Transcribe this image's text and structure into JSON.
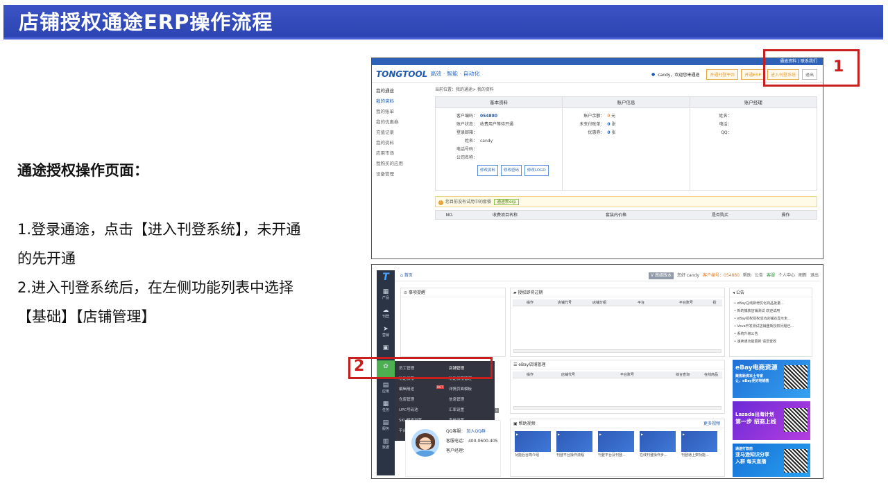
{
  "slide": {
    "title": "店铺授权通途ERP操作流程",
    "subhead": "通途授权操作页面：",
    "steps": [
      "1.登录通途，点击【进入刊登系统】，未开通",
      "的先开通",
      "2.进入刊登系统后，在左侧功能列表中选择",
      "【基础】【店铺管理】"
    ],
    "markers": {
      "one": "1",
      "two": "2"
    },
    "marker_color": "#c81e1e",
    "title_bg": "#3049b8"
  },
  "shot1": {
    "top_links": "通途资料 | 联系我们",
    "logo": "TONGTOOL",
    "slogan": "高效 · 智能 · 自动化",
    "welcome": "candy，欢迎您来通途",
    "header_buttons": [
      "开通刊登平台",
      "开通ERP",
      "进入刊登系统",
      "退出"
    ],
    "sidebar_title": "我的通途",
    "sidebar_items": [
      "我的资料",
      "我的账单",
      "我的优惠券",
      "充值记录",
      "我的资料",
      "应用市场",
      "我购买的应用",
      "设备管理"
    ],
    "crumb": "当前位置：我的通途> 我的资料",
    "cols": [
      "基本资料",
      "账户信息",
      "账户经理"
    ],
    "basic": {
      "rows": [
        {
          "k": "客户编码：",
          "v": "054880"
        },
        {
          "k": "账户状态：",
          "v": "收费用户等待开通"
        },
        {
          "k": "登录邮箱：",
          "v": ""
        },
        {
          "k": "姓名：",
          "v": "candy"
        },
        {
          "k": "电话号码：",
          "v": ""
        },
        {
          "k": "公司名称：",
          "v": ""
        }
      ],
      "buttons": [
        "修改资料",
        "修改密码",
        "修改LOGO"
      ]
    },
    "account": {
      "rows": [
        {
          "k": "账户余额：",
          "v": "0",
          "unit": "元"
        },
        {
          "k": "未支付账单：",
          "v": "0",
          "unit": "张"
        },
        {
          "k": "优惠券：",
          "v": "0",
          "unit": "张"
        }
      ]
    },
    "manager": {
      "rows": [
        "姓名：",
        "电话：",
        "QQ："
      ]
    },
    "notice": "您目前没有试用中的套餐",
    "notice_btn": "通途新erp",
    "svc_cols": [
      "NO.",
      "收费项目名称",
      "套装内价格",
      "是否购买",
      "操作"
    ]
  },
  "shot2": {
    "logo": "T",
    "rail": [
      {
        "icon": "grid-icon",
        "glyph": "▦",
        "label": "产品"
      },
      {
        "icon": "cloud-icon",
        "glyph": "☁",
        "label": "刊登"
      },
      {
        "icon": "plane-icon",
        "glyph": "➤",
        "label": "营销"
      },
      {
        "icon": "image-icon",
        "glyph": "▣",
        "label": ""
      },
      {
        "icon": "gear-icon",
        "glyph": "✿",
        "label": ""
      },
      {
        "icon": "store-icon",
        "glyph": "▤",
        "label": "应用"
      },
      {
        "icon": "calendar-icon",
        "glyph": "▦",
        "label": "任务"
      },
      {
        "icon": "shop-icon",
        "glyph": "▤",
        "label": "服务"
      },
      {
        "icon": "db-icon",
        "glyph": "▥",
        "label": "数据"
      }
    ],
    "home": "首页",
    "topbar": {
      "version": "V 高级版本",
      "greeting": "您好 candy",
      "customer": "客户编号：054880",
      "help": "帮助",
      "notice": "公告",
      "orders": "客服",
      "user": "个人中心",
      "refresh": "刷新",
      "exit": "退出"
    },
    "panels": {
      "todo": "事项提醒",
      "authexpire": "授权即将过期",
      "auth_cols": [
        "操作",
        "店铺代号",
        "店铺分组",
        "平台",
        "平台账号",
        "授"
      ],
      "ebay": "eBay店铺管理",
      "ebay_cols": [
        "操作",
        "店铺代号",
        "平台账号",
        "综合查询",
        "在线商品"
      ],
      "announce": "公告",
      "announce_items": [
        "eBay在线新增优化商品批量...",
        "新的捕获店铺测试 欢迎试用",
        "eBay授权授权成功店铺还显示未...",
        "Vova开发测试店铺重新授权问题已...",
        "系统升级公告",
        "速卖通功能更新 请您查收"
      ],
      "video": "帮助视频",
      "video_more": "更多视频",
      "videos": [
        "功能后台简介绍",
        "刊登平台操作流程",
        "刊登平台及刊登...",
        "在线刊登操作步...",
        "刊登通上架功能..."
      ]
    },
    "menu": {
      "left": [
        "员工管理",
        "功能权限",
        "编辑用途",
        "仓库管理",
        "UPC号码池",
        "SKU规格设置",
        "平台 自动化规则"
      ],
      "right": [
        "店铺管理",
        "功能权限管理",
        "详情页面模板",
        "信息管理",
        "汇率设置",
        "系统设置"
      ],
      "hot_label": "HOT"
    },
    "contact": {
      "qq": "QQ客服：",
      "qq_link": "加入QQ群",
      "phone_label": "客服电话：",
      "phone": "400-0600-405",
      "manager": "客户经理："
    },
    "ads": [
      {
        "line1": "eBay电商资源",
        "line2": "聚焦新资本土专家",
        "line3": "让，eBay更好地销售"
      },
      {
        "line1": "Lazada出海计划",
        "line2": "第一步 招商上线",
        "line3": ""
      },
      {
        "line1": "通途打款前",
        "line2": "亚马逊知识分享",
        "line3": "入群 每天直播"
      }
    ],
    "pager": "2"
  }
}
